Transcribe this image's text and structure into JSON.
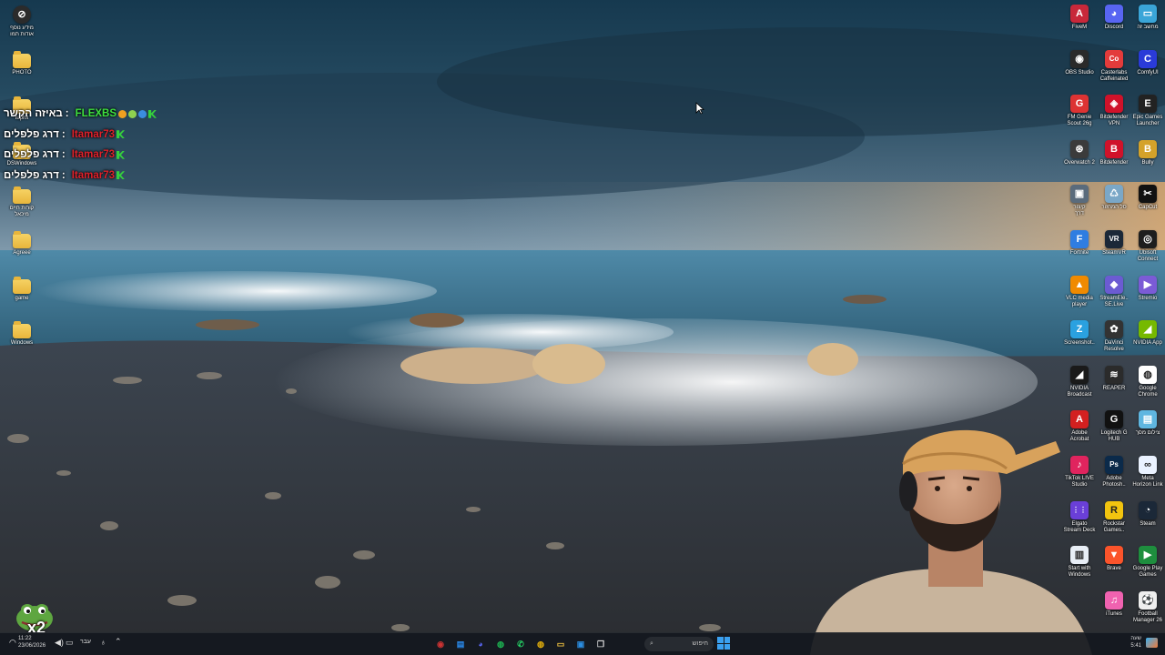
{
  "desktop_left": [
    {
      "label": "מידע נוסף\nאודות תמו",
      "icon": "info-icon",
      "type": "app",
      "color": "#2b2b2b",
      "glyph": "⊘"
    },
    {
      "label": "PHOTO",
      "icon": "folder-icon",
      "type": "folder"
    },
    {
      "label": "tuphx",
      "icon": "folder-icon",
      "type": "folder"
    },
    {
      "label": "DSWindows",
      "icon": "folder-icon",
      "type": "folder"
    },
    {
      "label": "קורות חיים\nמיכאל",
      "icon": "folder-icon",
      "type": "folder"
    },
    {
      "label": "Agreee",
      "icon": "folder-icon",
      "type": "folder"
    },
    {
      "label": "game",
      "icon": "folder-icon",
      "type": "folder"
    },
    {
      "label": "Windows",
      "icon": "folder-icon",
      "type": "folder"
    }
  ],
  "desktop_right": [
    {
      "label": "FiveM",
      "icon": "fivem-icon",
      "color": "#c8283a",
      "glyph": "A"
    },
    {
      "label": "Discord",
      "icon": "discord-icon",
      "color": "#5865f2",
      "glyph": "◕"
    },
    {
      "label": "מחשב זה",
      "icon": "this-pc-icon",
      "color": "#3aa5d8",
      "glyph": "▭"
    },
    {
      "label": "OBS Studio",
      "icon": "obs-icon",
      "color": "#2a2a2a",
      "glyph": "◉"
    },
    {
      "label": "Casterlabs\nCaffeinated",
      "icon": "casterlabs-icon",
      "color": "#e33b3b",
      "glyph": "Co"
    },
    {
      "label": "ComfyUI",
      "icon": "comfyui-icon",
      "color": "#2a3bd8",
      "glyph": "C"
    },
    {
      "label": "FM Genie\nScout 26g",
      "icon": "fm-genie-icon",
      "color": "#d33",
      "glyph": "G"
    },
    {
      "label": "Bitdefender\nVPN",
      "icon": "bitdefender-vpn-icon",
      "color": "#d0122a",
      "glyph": "◈"
    },
    {
      "label": "Epic Games\nLauncher",
      "icon": "epic-games-icon",
      "color": "#222",
      "glyph": "E"
    },
    {
      "label": "Overwatch 2",
      "icon": "overwatch-icon",
      "color": "#3b3b3b",
      "glyph": "⊛"
    },
    {
      "label": "Bitdefender",
      "icon": "bitdefender-icon",
      "color": "#d0122a",
      "glyph": "B"
    },
    {
      "label": "Bully",
      "icon": "bully-icon",
      "color": "#d4a22a",
      "glyph": "B"
    },
    {
      "label": "קיצור\nדרך",
      "icon": "game-shortcut-icon",
      "color": "#5a6b7c",
      "glyph": "▣"
    },
    {
      "label": "סל המחזור",
      "icon": "recycle-bin-icon",
      "color": "#7aa7c7",
      "glyph": "♺"
    },
    {
      "label": "CapCut",
      "icon": "capcut-icon",
      "color": "#111",
      "glyph": "✂"
    },
    {
      "label": "Fortnite",
      "icon": "fortnite-icon",
      "color": "#2f7de1",
      "glyph": "F"
    },
    {
      "label": "SteamVR",
      "icon": "steamvr-icon",
      "color": "#1b2838",
      "glyph": "VR"
    },
    {
      "label": "Ubisoft\nConnect",
      "icon": "ubisoft-icon",
      "color": "#1e1e1e",
      "glyph": "◎"
    },
    {
      "label": "VLC media\nplayer",
      "icon": "vlc-icon",
      "color": "#f08a00",
      "glyph": "▲"
    },
    {
      "label": "StreamEle..\nSE.Live",
      "icon": "streamelements-icon",
      "color": "#6b5bd2",
      "glyph": "◆"
    },
    {
      "label": "Stremio",
      "icon": "stremio-icon",
      "color": "#7b5bd6",
      "glyph": "▶"
    },
    {
      "label": "Screenshot..",
      "icon": "screenshot-icon",
      "color": "#2aa1e0",
      "glyph": "Z"
    },
    {
      "label": "DaVinci\nResolve",
      "icon": "davinci-icon",
      "color": "#333",
      "glyph": "✿"
    },
    {
      "label": "NVIDIA App",
      "icon": "nvidia-app-icon",
      "color": "#76b900",
      "glyph": "◢"
    },
    {
      "label": "NVIDIA\nBroadcast",
      "icon": "nvidia-broadcast-icon",
      "color": "#1a1a1a",
      "glyph": "◢"
    },
    {
      "label": "REAPER",
      "icon": "reaper-icon",
      "color": "#2b2b2b",
      "glyph": "≋"
    },
    {
      "label": "Google\nChrome",
      "icon": "chrome-icon",
      "color": "#ffffff",
      "glyph": "◍"
    },
    {
      "label": "Adobe\nAcrobat",
      "icon": "acrobat-icon",
      "color": "#d32020",
      "glyph": "A"
    },
    {
      "label": "Logitech G\nHUB",
      "icon": "logitech-ghub-icon",
      "color": "#111",
      "glyph": "G"
    },
    {
      "label": "צילום מסך",
      "icon": "screen-capture-icon",
      "color": "#5fb6e0",
      "glyph": "▤"
    },
    {
      "label": "TikTok LIVE\nStudio",
      "icon": "tiktok-live-icon",
      "color": "#e0245e",
      "glyph": "♪"
    },
    {
      "label": "Adobe\nPhotosh..",
      "icon": "photoshop-icon",
      "color": "#0b2a4a",
      "glyph": "Ps"
    },
    {
      "label": "Meta\nHorizon Link",
      "icon": "meta-horizon-icon",
      "color": "#eaf2ff",
      "glyph": "∞"
    },
    {
      "label": "Elgato\nStream Deck",
      "icon": "stream-deck-icon",
      "color": "#6a3fd8",
      "glyph": "⋮⋮"
    },
    {
      "label": "Rockstar\nGames..",
      "icon": "rockstar-icon",
      "color": "#f2c40f",
      "glyph": "R"
    },
    {
      "label": "Steam",
      "icon": "steam-icon",
      "color": "#1b2838",
      "glyph": "◔"
    },
    {
      "label": "Start with\nWindows",
      "icon": "document-icon",
      "color": "#e8eef6",
      "glyph": "▥"
    },
    {
      "label": "Brave",
      "icon": "brave-icon",
      "color": "#fb542b",
      "glyph": "▼"
    },
    {
      "label": "Google Play\nGames",
      "icon": "google-play-games-icon",
      "color": "#1e8e3e",
      "glyph": "▶"
    },
    {
      "label": "",
      "icon": "blank-icon",
      "color": "transparent",
      "glyph": ""
    },
    {
      "label": "iTunes",
      "icon": "itunes-icon",
      "color": "#f062b0",
      "glyph": "♫"
    },
    {
      "label": "Football\nManager 26",
      "icon": "football-manager-icon",
      "color": "#eeeeee",
      "glyph": "⚽"
    }
  ],
  "chat": [
    {
      "user": "FLEXBS",
      "message": "באיזה הקשר",
      "user_color": "#3ee03e",
      "extra_badges": true
    },
    {
      "user": "Itamar73",
      "message": "דרג פלפלים",
      "user_color": "#e0202a",
      "extra_badges": false
    },
    {
      "user": "Itamar73",
      "message": "דרג פלפלים",
      "user_color": "#e0202a",
      "extra_badges": false
    },
    {
      "user": "Itamar73",
      "message": "דרג פלפלים",
      "user_color": "#e0202a",
      "extra_badges": false
    }
  ],
  "emote_badge": "x2",
  "taskbar": {
    "search_placeholder": "חיפוש",
    "pinned": [
      {
        "name": "obs-taskbar-icon",
        "glyph": "◉",
        "color": "#c33"
      },
      {
        "name": "notes-taskbar-icon",
        "glyph": "▤",
        "color": "#2a8cf0"
      },
      {
        "name": "discord-taskbar-icon",
        "glyph": "◕",
        "color": "#5865f2"
      },
      {
        "name": "spotify-taskbar-icon",
        "glyph": "◍",
        "color": "#1db954"
      },
      {
        "name": "whatsapp-taskbar-icon",
        "glyph": "✆",
        "color": "#25d366"
      },
      {
        "name": "chrome-taskbar-icon",
        "glyph": "◍",
        "color": "#e9b40b"
      },
      {
        "name": "file-explorer-taskbar-icon",
        "glyph": "▭",
        "color": "#f4c542"
      },
      {
        "name": "store-taskbar-icon",
        "glyph": "▣",
        "color": "#2b8de0"
      },
      {
        "name": "task-view-taskbar-icon",
        "glyph": "❐",
        "color": "#ddd"
      }
    ],
    "tray_left_time": "11:22",
    "tray_left_date": "23/06/2026",
    "tray_lang": "עבר",
    "clock_time": "5:41",
    "clock_label": "שעה"
  }
}
